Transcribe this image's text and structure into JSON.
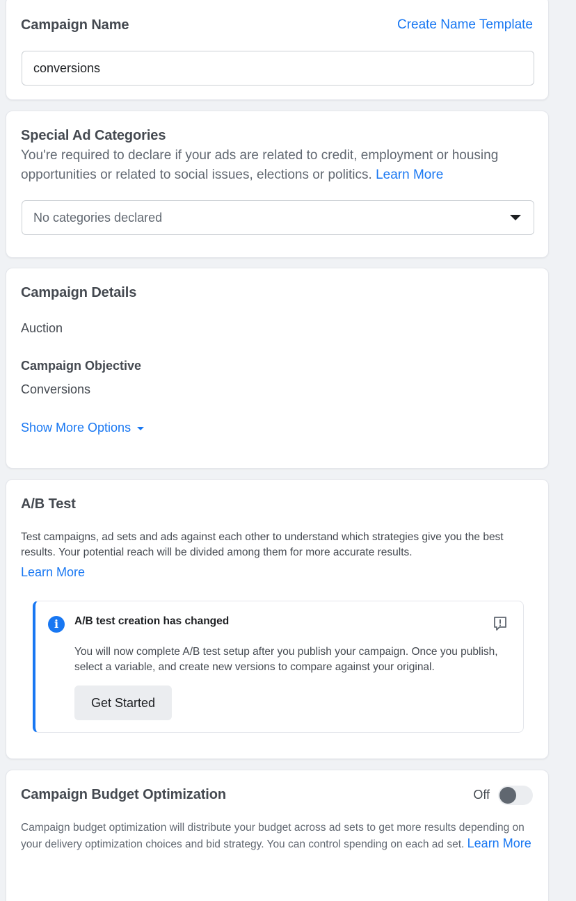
{
  "campaign_name": {
    "title": "Campaign Name",
    "template_link": "Create Name Template",
    "value": "conversions"
  },
  "special_categories": {
    "title": "Special Ad Categories",
    "description": "You're required to declare if your ads are related to credit, employment or housing opportunities or related to social issues, elections or politics.",
    "learn_more": "Learn More",
    "select_placeholder": "No categories declared",
    "caret_icon": "caret-down-icon"
  },
  "campaign_details": {
    "title": "Campaign Details",
    "buying_type": "Auction",
    "objective_label": "Campaign Objective",
    "objective_value": "Conversions",
    "show_more": "Show More Options",
    "show_more_icon": "caret-down-icon"
  },
  "ab_test": {
    "title": "A/B Test",
    "description": "Test campaigns, ad sets and ads against each other to understand which strategies give you the best results. Your potential reach will be divided among them for more accurate results.",
    "learn_more": "Learn More",
    "notice": {
      "icon": "info-icon",
      "title": "A/B test creation has changed",
      "body": "You will now complete A/B test setup after you publish your campaign. Once you publish, select a variable, and create new versions to compare against your original.",
      "button": "Get Started",
      "feedback_icon": "feedback-icon"
    }
  },
  "budget_optimization": {
    "title": "Campaign Budget Optimization",
    "toggle_label": "Off",
    "toggle_on": false,
    "description": "Campaign budget optimization will distribute your budget across ad sets to get more results depending on your delivery optimization choices and bid strategy. You can control spending on each ad set.",
    "learn_more": "Learn More"
  },
  "colors": {
    "accent": "#1877f2",
    "background": "#f0f2f5",
    "card": "#ffffff"
  }
}
